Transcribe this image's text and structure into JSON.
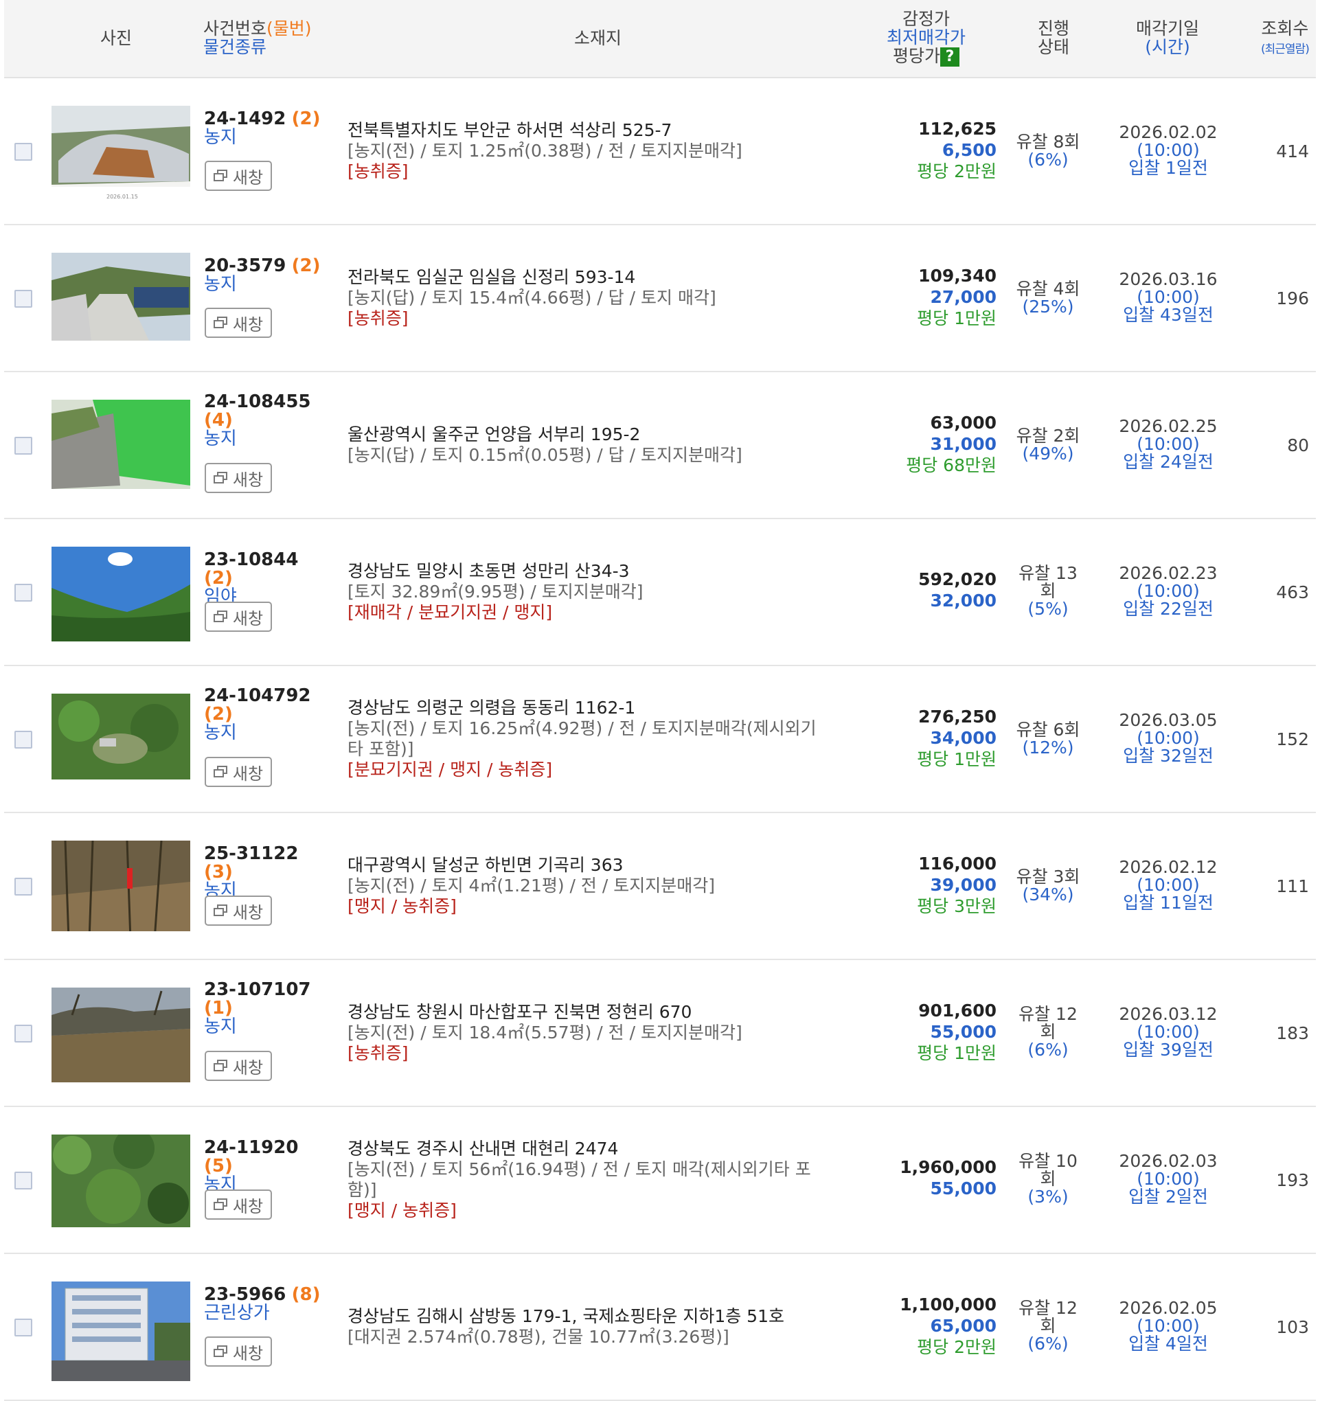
{
  "header": {
    "photo": "사진",
    "case_no": "사건번호",
    "item_no": "(물번)",
    "item_type": "물건종류",
    "location": "소재지",
    "appraisal": "감정가",
    "min_price": "최저매각가",
    "per_pyeong": "평당가",
    "help_mark": "?",
    "status_line1": "진행",
    "status_line2": "상태",
    "date_label": "매각기일",
    "time_label": "(시간)",
    "views_label": "조회수",
    "recent_view": "(최근열람)"
  },
  "new_window_label": "새창",
  "rows": [
    {
      "case": "24-1492",
      "count": "(2)",
      "kind": "농지",
      "addr": "전북특별자치도 부안군 하서면 석상리 525-7",
      "detail": "[농지(전) / 토지 1.25㎡(0.38평) / 전 / 토지지분매각]",
      "tags": "[농취증]",
      "appraisal": "112,625",
      "min": "6,500",
      "per": "평당 2만원",
      "status1": "유찰 8회",
      "status2": "(6%)",
      "date": "2026.02.02",
      "time": "(10:00)",
      "remain": "입찰 1일전",
      "views": "414",
      "photo": "greenhouse"
    },
    {
      "case": "20-3579",
      "count": "(2)",
      "kind": "농지",
      "addr": "전라북도 임실군 임실읍 신정리 593-14",
      "detail": "[농지(답) / 토지 15.4㎡(4.66평) / 답 / 토지 매각]",
      "tags": "[농취증]",
      "appraisal": "109,340",
      "min": "27,000",
      "per": "평당 1만원",
      "status1": "유찰 4회",
      "status2": "(25%)",
      "date": "2026.03.16",
      "time": "(10:00)",
      "remain": "입찰 43일전",
      "views": "196",
      "photo": "road"
    },
    {
      "case": "24-108455",
      "count": "(4)",
      "kind": "농지",
      "addr": "울산광역시 울주군 언양읍 서부리 195-2",
      "detail": "[농지(답) / 토지 0.15㎡(0.05평) / 답 / 토지지분매각]",
      "tags": "",
      "appraisal": "63,000",
      "min": "31,000",
      "per": "평당 68만원",
      "status1": "유찰 2회",
      "status2": "(49%)",
      "date": "2026.02.25",
      "time": "(10:00)",
      "remain": "입찰 24일전",
      "views": "80",
      "photo": "greenwall"
    },
    {
      "case": "23-10844",
      "count": "(2)",
      "kind": "임야",
      "addr": "경상남도 밀양시 초동면 성만리 산34-3",
      "detail": "[토지 32.89㎡(9.95평) / 토지지분매각]",
      "tags": "[재매각 / 분묘기지권 / 맹지]",
      "appraisal": "592,020",
      "min": "32,000",
      "per": "",
      "status1": "유찰 13",
      "status1b": "회",
      "status2": "(5%)",
      "date": "2026.02.23",
      "time": "(10:00)",
      "remain": "입찰 22일전",
      "views": "463",
      "photo": "sky"
    },
    {
      "case": "24-104792",
      "count": "(2)",
      "kind": "농지",
      "addr": "경상남도 의령군 의령읍 동동리 1162-1",
      "detail": "[농지(전) / 토지 16.25㎡(4.92평) / 전 / 토지지분매각(제시외기타 포함)]",
      "tags": "[분묘기지권 / 맹지 / 농취증]",
      "appraisal": "276,250",
      "min": "34,000",
      "per": "평당 1만원",
      "status1": "유찰 6회",
      "status2": "(12%)",
      "date": "2026.03.05",
      "time": "(10:00)",
      "remain": "입찰 32일전",
      "views": "152",
      "photo": "bushes"
    },
    {
      "case": "25-31122",
      "count": "(3)",
      "kind": "농지",
      "addr": "대구광역시 달성군 하빈면 기곡리 363",
      "detail": "[농지(전) / 토지 4㎡(1.21평) / 전 / 토지지분매각]",
      "tags": "[맹지 / 농취증]",
      "appraisal": "116,000",
      "min": "39,000",
      "per": "평당 3만원",
      "status1": "유찰 3회",
      "status2": "(34%)",
      "date": "2026.02.12",
      "time": "(10:00)",
      "remain": "입찰 11일전",
      "views": "111",
      "photo": "forest"
    },
    {
      "case": "23-107107",
      "count": "(1)",
      "kind": "농지",
      "addr": "경상남도 창원시 마산합포구 진북면 정현리 670",
      "detail": "[농지(전) / 토지 18.4㎡(5.57평) / 전 / 토지지분매각]",
      "tags": "[농취증]",
      "appraisal": "901,600",
      "min": "55,000",
      "per": "평당 1만원",
      "status1": "유찰 12",
      "status1b": "회",
      "status2": "(6%)",
      "date": "2026.03.12",
      "time": "(10:00)",
      "remain": "입찰 39일전",
      "views": "183",
      "photo": "dryfield"
    },
    {
      "case": "24-11920",
      "count": "(5)",
      "kind": "농지",
      "addr": "경상북도 경주시 산내면 대현리 2474",
      "detail": "[농지(전) / 토지 56㎡(16.94평) / 전 / 토지 매각(제시외기타 포함)]",
      "tags": "[맹지 / 농취증]",
      "appraisal": "1,960,000",
      "min": "55,000",
      "per": "",
      "status1": "유찰 10",
      "status1b": "회",
      "status2": "(3%)",
      "date": "2026.02.03",
      "time": "(10:00)",
      "remain": "입찰 2일전",
      "views": "193",
      "photo": "jungle"
    },
    {
      "case": "23-5966",
      "count": "(8)",
      "kind": "근린상가",
      "addr": "경상남도 김해시 삼방동 179-1, 국제쇼핑타운 지하1층 51호",
      "detail": "[대지권 2.574㎡(0.78평), 건물 10.77㎡(3.26평)]",
      "tags": "",
      "appraisal": "1,100,000",
      "min": "65,000",
      "per": "평당 2만원",
      "status1": "유찰 12",
      "status1b": "회",
      "status2": "(6%)",
      "date": "2026.02.05",
      "time": "(10:00)",
      "remain": "입찰 4일전",
      "views": "103",
      "photo": "building"
    }
  ]
}
